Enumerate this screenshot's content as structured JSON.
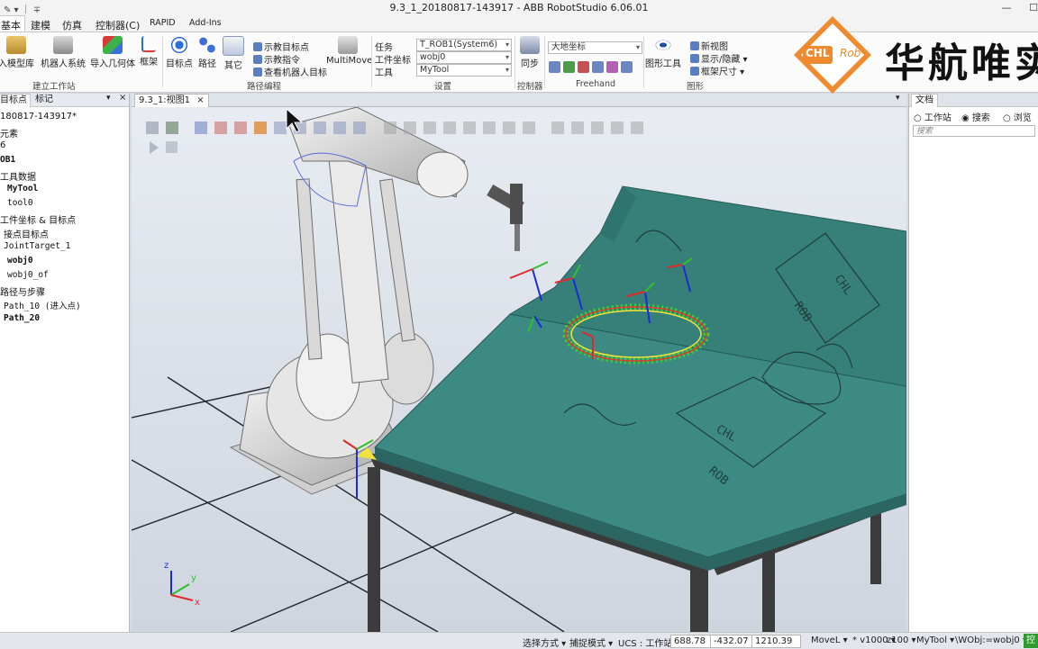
{
  "window": {
    "title": "9.3_1_20180817-143917 - ABB RobotStudio 6.06.01",
    "minimize": "—",
    "maximize": "☐"
  },
  "ribbon_tabs": [
    "基本",
    "建模",
    "仿真",
    "控制器(C)",
    "RAPID",
    "Add-Ins"
  ],
  "ribbon": {
    "build_station": {
      "label": "建立工作站",
      "buttons": [
        "入模型库",
        "机器人系统",
        "导入几何体",
        "框架"
      ]
    },
    "path_programming": {
      "label": "路径编程",
      "buttons": [
        "目标点",
        "路径",
        "其它"
      ],
      "small": [
        "示教目标点",
        "示教指令",
        "查看机器人目标"
      ],
      "multimove": "MultiMove"
    },
    "settings": {
      "label": "设置",
      "rows": [
        {
          "label": "任务",
          "value": "T_ROB1(System6)"
        },
        {
          "label": "工件坐标",
          "value": "wobj0"
        },
        {
          "label": "工具",
          "value": "MyTool"
        }
      ]
    },
    "controller": {
      "label": "控制器",
      "sync": "同步"
    },
    "freehand": {
      "label": "Freehand",
      "frame": "大地坐标"
    },
    "graphics": {
      "label": "图形",
      "graphics_tools": "图形工具",
      "items": [
        "新视图",
        "显示/隐藏",
        "框架尺寸"
      ]
    }
  },
  "logo": {
    "badge_left": "CHL",
    "badge_right": "Rob",
    "text": "华航唯实"
  },
  "left_panel": {
    "tabs": [
      "目标点",
      "标记"
    ],
    "tree": [
      {
        "text": "180817-143917*",
        "bold": false,
        "mono": false
      },
      {
        "text": "元素",
        "bold": false,
        "mono": false
      },
      {
        "text": "6",
        "bold": false,
        "mono": false
      },
      {
        "text": "OB1",
        "bold": true,
        "mono": true
      },
      {
        "text": "工具数据",
        "bold": false,
        "mono": false
      },
      {
        "text": "MyTool",
        "bold": true,
        "mono": true
      },
      {
        "text": "tool0",
        "bold": false,
        "mono": true
      },
      {
        "text": "工件坐标 & 目标点",
        "bold": false,
        "mono": false
      },
      {
        "text": "接点目标点",
        "bold": false,
        "mono": false
      },
      {
        "text": "JointTarget_1",
        "bold": false,
        "mono": true
      },
      {
        "text": "wobj0",
        "bold": true,
        "mono": true
      },
      {
        "text": "wobj0_of",
        "bold": false,
        "mono": true
      },
      {
        "text": "路径与步骤",
        "bold": false,
        "mono": false
      },
      {
        "text": "Path_10 (进入点)",
        "bold": false,
        "mono": true
      },
      {
        "text": "Path_20",
        "bold": true,
        "mono": true
      }
    ]
  },
  "viewport": {
    "tab": "9.3_1:视图1",
    "axis": {
      "x": "x",
      "y": "y",
      "z": "z"
    },
    "engrave_text": [
      "CHL",
      "ROB"
    ]
  },
  "right_panel": {
    "title": "文档",
    "options": [
      "工作站",
      "搜索",
      "浏览"
    ],
    "selected": "搜索",
    "search_placeholder": "搜索"
  },
  "status_bar": {
    "select_mode": "选择方式",
    "snap_mode": "捕捉模式",
    "ucs": "UCS : 工作站",
    "coords": [
      "688.78",
      "-432.07",
      "1210.39"
    ],
    "instruction": "MoveL",
    "speed": "v1000",
    "zone": "z100",
    "tool": "MyTool",
    "wobj": "\\WObj:=wobj0",
    "control": "控"
  },
  "colors": {
    "table_top": "#3d8a85",
    "viewport_bg": "#dde2ea",
    "robot": "#e2e2e2",
    "logo_orange": "#ef8a2e"
  }
}
